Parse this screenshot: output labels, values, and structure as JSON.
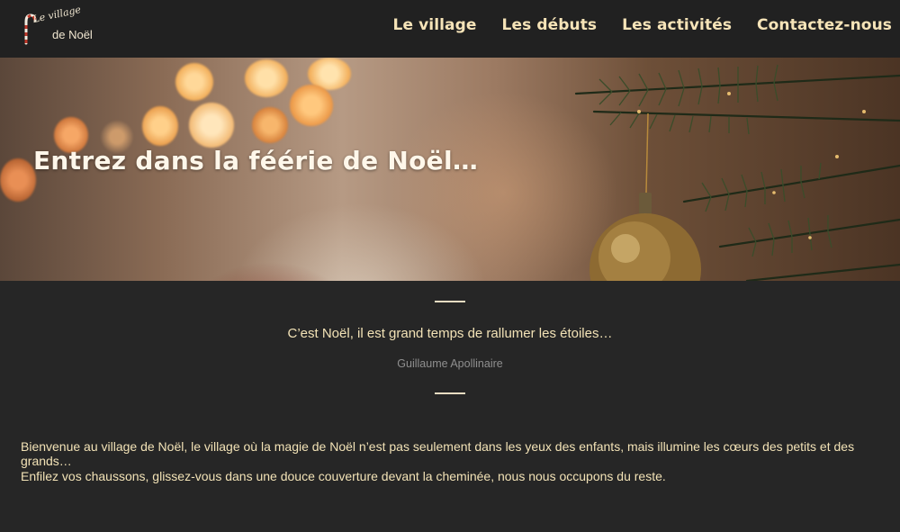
{
  "logo": {
    "line1": "Le village",
    "line2": "de Noël"
  },
  "nav": {
    "items": [
      {
        "label": "Le village"
      },
      {
        "label": "Les débuts"
      },
      {
        "label": "Les activités"
      },
      {
        "label": "Contactez-nous"
      }
    ]
  },
  "hero": {
    "title": "Entrez dans la féérie de Noël…"
  },
  "quote": {
    "text": "C’est Noël, il est grand temps de rallumer les étoiles…",
    "author": "Guillaume Apollinaire"
  },
  "intro": {
    "paragraphs": [
      "Bienvenue au village de Noël, le village où la magie de Noël n’est pas seulement dans les yeux des enfants, mais illumine les cœurs des petits et des grands…",
      "Enfilez vos chaussons, glissez-vous dans une douce couverture devant la cheminée, nous nous occupons du reste."
    ]
  },
  "colors": {
    "background": "#262626",
    "navbar": "#212121",
    "accent_text": "#f6e4b8",
    "muted_text": "#8f8f8f"
  }
}
